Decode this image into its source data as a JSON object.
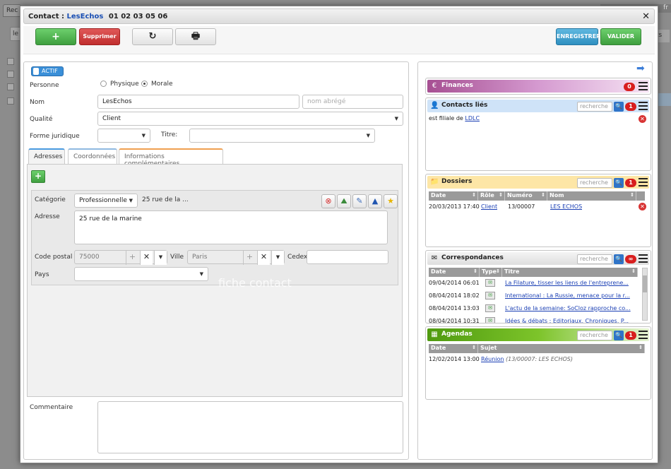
{
  "background": {
    "tab_label": "Rec",
    "button_label": "le",
    "right_btn_label": "cts",
    "right_top_label": "fr"
  },
  "modal": {
    "title_prefix": "Contact :",
    "contact_name": "LesEchos",
    "phone": "01 02 03 05 06"
  },
  "toolbar": {
    "add_label": "+",
    "delete_label": "Supprimer",
    "refresh_icon": "↻",
    "print_icon": "🖶",
    "save_label": "ENREGISTRER",
    "validate_label": "VALIDER"
  },
  "form": {
    "status_label": "ACTIF",
    "personne_label": "Personne",
    "physique_label": "Physique",
    "morale_label": "Morale",
    "nom_label": "Nom",
    "nom_value": "LesEchos",
    "nom_abrege_placeholder": "nom abrégé",
    "qualite_label": "Qualité",
    "qualite_value": "Client",
    "forme_juridique_label": "Forme juridique",
    "forme_juridique_value": "",
    "titre_label": "Titre:",
    "titre_value": ""
  },
  "tabs": {
    "adresses": "Adresses",
    "coordonnees": "Coordonnées",
    "infos": "Informations complémentaires"
  },
  "address": {
    "add_label": "+",
    "categorie_label": "Catégorie",
    "categorie_value": "Professionnelle",
    "summary": "25 rue de la ...",
    "adresse_label": "Adresse",
    "adresse_value": "25 rue de la marine",
    "code_postal_label": "Code postal",
    "code_postal_value": "75000",
    "ville_label": "Ville",
    "ville_value": "Paris",
    "cedex_label": "Cedex",
    "cedex_value": "",
    "pays_label": "Pays",
    "pays_value": ""
  },
  "watermark": "fiche contact",
  "commentaire_label": "Commentaire",
  "widgets": {
    "search_placeholder": "recherche",
    "finances": {
      "title": "Finances",
      "count": "0",
      "color": "#b05a9a"
    },
    "contacts": {
      "title": "Contacts liés",
      "count": "1",
      "row_text": "est filiale de",
      "row_link": "LDLC"
    },
    "dossiers": {
      "title": "Dossiers",
      "count": "1",
      "columns": [
        "Date",
        "Rôle",
        "Numéro",
        "Nom"
      ],
      "rows": [
        {
          "date": "20/03/2013 17:40",
          "role": "Client",
          "numero": "13/00007",
          "nom": "LES ECHOS"
        }
      ]
    },
    "correspondances": {
      "title": "Correspondances",
      "count": "∞",
      "columns": [
        "Date",
        "Type",
        "Titre"
      ],
      "rows": [
        {
          "date": "09/04/2014 06:01",
          "titre": "La Filature, tisser les liens de l'entreprene..."
        },
        {
          "date": "08/04/2014 18:02",
          "titre": "International : La Russie, menace pour la r..."
        },
        {
          "date": "08/04/2014 13:03",
          "titre": "L'actu de la semaine: SoCloz rapproche co..."
        },
        {
          "date": "08/04/2014 10:31",
          "titre": "Idées & débats : Editoriaux, Chroniques, P..."
        }
      ]
    },
    "agendas": {
      "title": "Agendas",
      "count": "1",
      "columns": [
        "Date",
        "Sujet"
      ],
      "rows": [
        {
          "date": "12/02/2014 13:00",
          "sujet_link": "Réunion",
          "sujet_extra": "(13/00007: LES ECHOS)"
        }
      ]
    }
  }
}
